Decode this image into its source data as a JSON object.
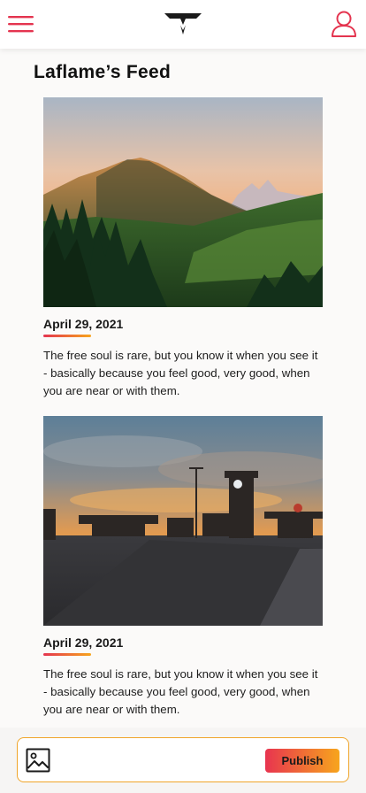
{
  "header": {
    "menu_icon": "hamburger-menu-icon",
    "logo_icon": "brand-logo",
    "profile_icon": "user-profile-icon",
    "accent_color": "#e4344f"
  },
  "feed": {
    "title": "Laflame’s Feed",
    "posts": [
      {
        "image": "mountain-valley-sunset-photo",
        "date": "April 29, 2021",
        "text": "The free soul is rare, but you know it when you see it - basically because you feel good, very good, when you are near or with them."
      },
      {
        "image": "station-clock-tower-sunset-photo",
        "date": "April 29, 2021",
        "text": "The free soul is rare, but you know it when you see it - basically because you feel good, very good, when you are near or with them."
      }
    ]
  },
  "composer": {
    "image_icon": "image-icon",
    "placeholder": "",
    "publish_label": "Publish",
    "border_color": "#f0a52a"
  }
}
